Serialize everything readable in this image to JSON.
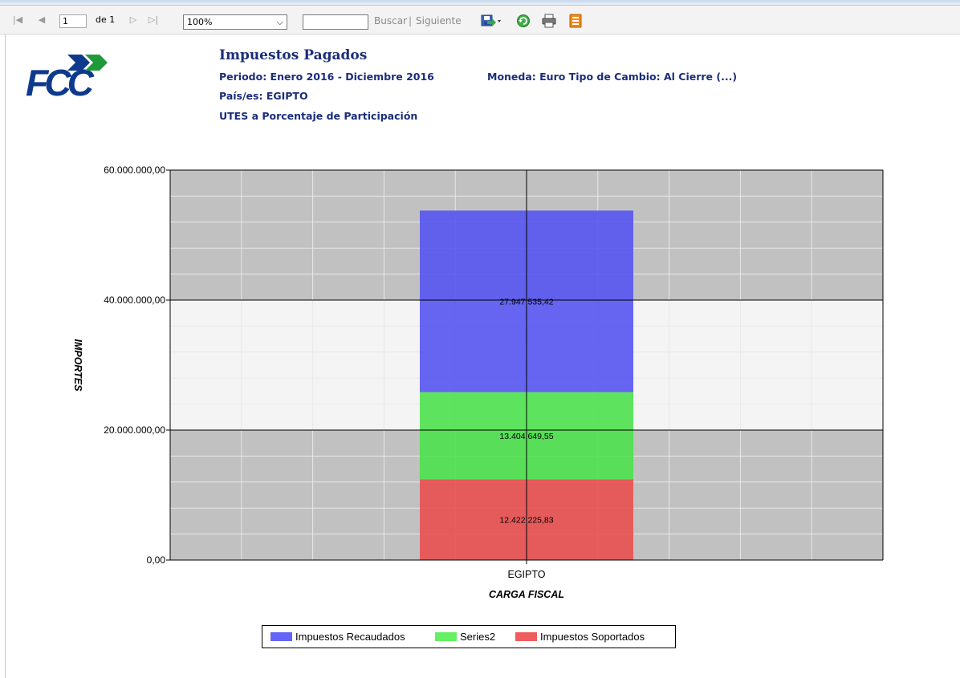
{
  "toolbar": {
    "page_value": "1",
    "page_of": "de 1",
    "zoom_value": "100%",
    "find_value": "",
    "find_label": "Buscar",
    "separator": "|",
    "next_label": "Siguiente"
  },
  "report": {
    "logo_text": "FCC",
    "title": "Impuestos Pagados",
    "period": "Periodo: Enero 2016 - Diciembre 2016",
    "currency": "Moneda: Euro Tipo de Cambio: Al Cierre (...)",
    "country": "País/es: EGIPTO",
    "utes": "UTES a Porcentaje de Participación"
  },
  "colors": {
    "title_blue": "#1b2d7a",
    "logo_blue": "#0e3a8e",
    "logo_green": "#1f9a3b",
    "plot_gray": "#c1c1c1",
    "plot_light": "#f4f4f4"
  },
  "chart_data": {
    "type": "bar",
    "stacked": true,
    "categories": [
      "EGIPTO"
    ],
    "series": [
      {
        "name": "Impuestos Soportados",
        "values": [
          12422225.83
        ],
        "color": "#e85353",
        "label": "12.422.225,83"
      },
      {
        "name": "Series2",
        "values": [
          13404649.55
        ],
        "color": "#4fe14f",
        "label": "13.404.649,55"
      },
      {
        "name": "Impuestos Recaudados",
        "values": [
          27947535.42
        ],
        "color": "#5858f0",
        "label": "27.947.535,42"
      }
    ],
    "xlabel": "CARGA FISCAL",
    "ylabel": "IMPORTES",
    "ylim": [
      0,
      60000000
    ],
    "yticks": [
      {
        "value": 0,
        "label": "0,00"
      },
      {
        "value": 20000000,
        "label": "20.000.000,00"
      },
      {
        "value": 40000000,
        "label": "40.000.000,00"
      },
      {
        "value": 60000000,
        "label": "60.000.000,00"
      }
    ],
    "legend": {
      "placement": "bottom",
      "entries": [
        {
          "name": "Impuestos Recaudados",
          "color": "#6464f8"
        },
        {
          "name": "Series2",
          "color": "#64f064"
        },
        {
          "name": "Impuestos Soportados",
          "color": "#ee5c5c"
        }
      ]
    },
    "grid": true
  }
}
